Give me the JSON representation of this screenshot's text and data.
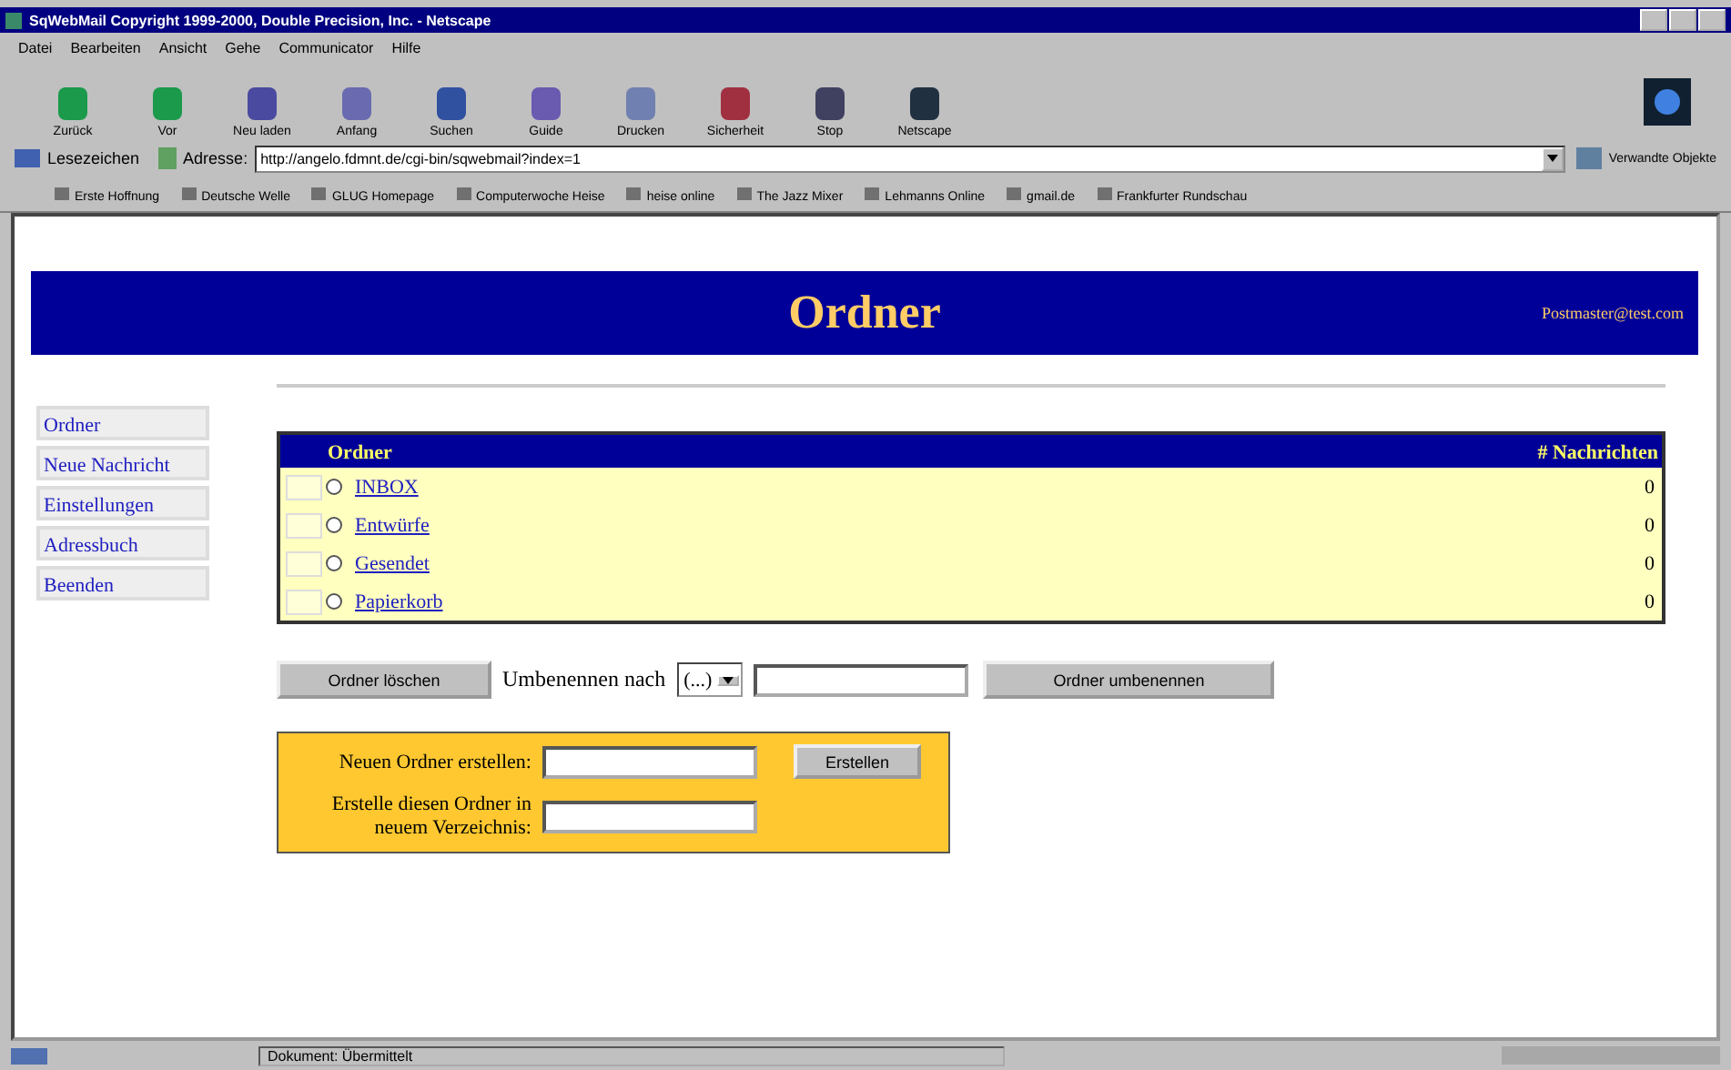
{
  "window": {
    "title": "SqWebMail Copyright 1999-2000, Double Precision, Inc. - Netscape"
  },
  "menu": [
    "Datei",
    "Bearbeiten",
    "Ansicht",
    "Gehe",
    "Communicator",
    "Hilfe"
  ],
  "toolbar": [
    {
      "label": "Zurück",
      "kind": "back"
    },
    {
      "label": "Vor",
      "kind": "forward"
    },
    {
      "label": "Neu laden",
      "kind": "reload"
    },
    {
      "label": "Anfang",
      "kind": "home"
    },
    {
      "label": "Suchen",
      "kind": "search"
    },
    {
      "label": "Guide",
      "kind": "guide"
    },
    {
      "label": "Drucken",
      "kind": "print"
    },
    {
      "label": "Sicherheit",
      "kind": "security"
    },
    {
      "label": "Stop",
      "kind": "stop"
    },
    {
      "label": "Netscape",
      "kind": "netscape"
    }
  ],
  "location": {
    "bookmarks_label": "Lesezeichen",
    "address_label": "Adresse:",
    "url": "http://angelo.fdmnt.de/cgi-bin/sqwebmail?index=1",
    "related_label": "Verwandte Objekte"
  },
  "bookmarks": [
    "Erste Hoffnung",
    "Deutsche Welle",
    "GLUG Homepage",
    "Computerwoche Heise",
    "heise online",
    "The Jazz Mixer",
    "Lehmanns Online",
    "gmail.de",
    "Frankfurter Rundschau"
  ],
  "page": {
    "header": {
      "title": "Ordner",
      "email": "Postmaster@test.com"
    },
    "sidebar": [
      {
        "label": "Ordner"
      },
      {
        "label": "Neue Nachricht"
      },
      {
        "label": "Einstellungen"
      },
      {
        "label": "Adressbuch"
      },
      {
        "label": "Beenden"
      }
    ],
    "table": {
      "columns": [
        "Ordner",
        "# Nachrichten"
      ],
      "rows": [
        {
          "name": "INBOX",
          "count": "0",
          "selected": false
        },
        {
          "name": "Entwürfe",
          "count": "0",
          "selected": false
        },
        {
          "name": "Gesendet",
          "count": "0",
          "selected": false
        },
        {
          "name": "Papierkorb",
          "count": "0",
          "selected": false
        }
      ]
    },
    "actions": {
      "delete_button": "Ordner löschen",
      "rename_label": "Umbenennen nach",
      "rename_select": "(...)",
      "rename_button": "Ordner umbenennen"
    },
    "create": {
      "new_label": "Neuen Ordner erstellen:",
      "create_button": "Erstellen",
      "parent_label": "Erstelle diesen Ordner in neuem Verzeichnis:"
    }
  },
  "status_bar": {
    "text": "Dokument: Übermittelt"
  }
}
